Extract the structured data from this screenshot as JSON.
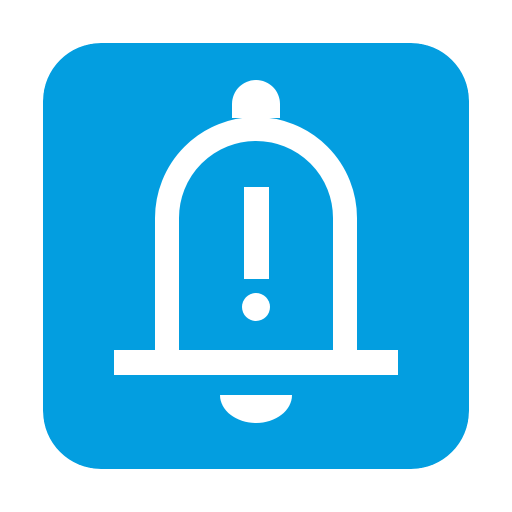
{
  "icon": {
    "name": "bell-alert-icon",
    "background_color": "#039ee0",
    "foreground_color": "#ffffff"
  }
}
